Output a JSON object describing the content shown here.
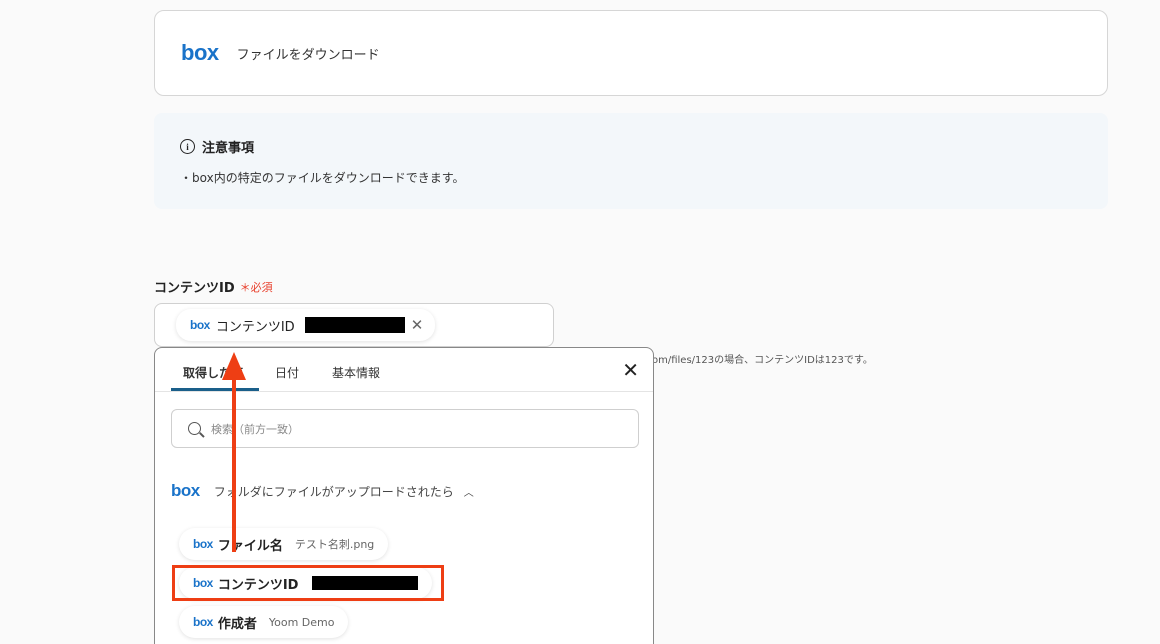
{
  "action_card": {
    "logo": "box",
    "label": "ファイルをダウンロード"
  },
  "notice": {
    "title": "注意事項",
    "info_icon": "i",
    "body": "・box内の特定のファイルをダウンロードできます。"
  },
  "field": {
    "label": "コンテンツID",
    "required": "＊必須"
  },
  "input_chip": {
    "logo": "box",
    "label": "コンテンツID",
    "close": "✕"
  },
  "helper_text": "om/files/123の場合、コンテンツIDは123です。",
  "dropdown": {
    "tabs": [
      "取得した値",
      "日付",
      "基本情報"
    ],
    "close": "✕",
    "search_placeholder": "検索（前方一致）",
    "group": {
      "logo": "box",
      "label": "フォルダにファイルがアップロードされたら",
      "chevron": "︿"
    },
    "outputs": [
      {
        "logo": "box",
        "name": "ファイル名",
        "value": "テスト名刺.png"
      },
      {
        "logo": "box",
        "name": "コンテンツID",
        "value": ""
      },
      {
        "logo": "box",
        "name": "作成者",
        "value": "Yoom Demo"
      }
    ]
  },
  "colors": {
    "accent": "#1a5f8a",
    "annotation": "#ee3e14",
    "required": "#e8412e",
    "box_blue": "#1a73c9"
  }
}
